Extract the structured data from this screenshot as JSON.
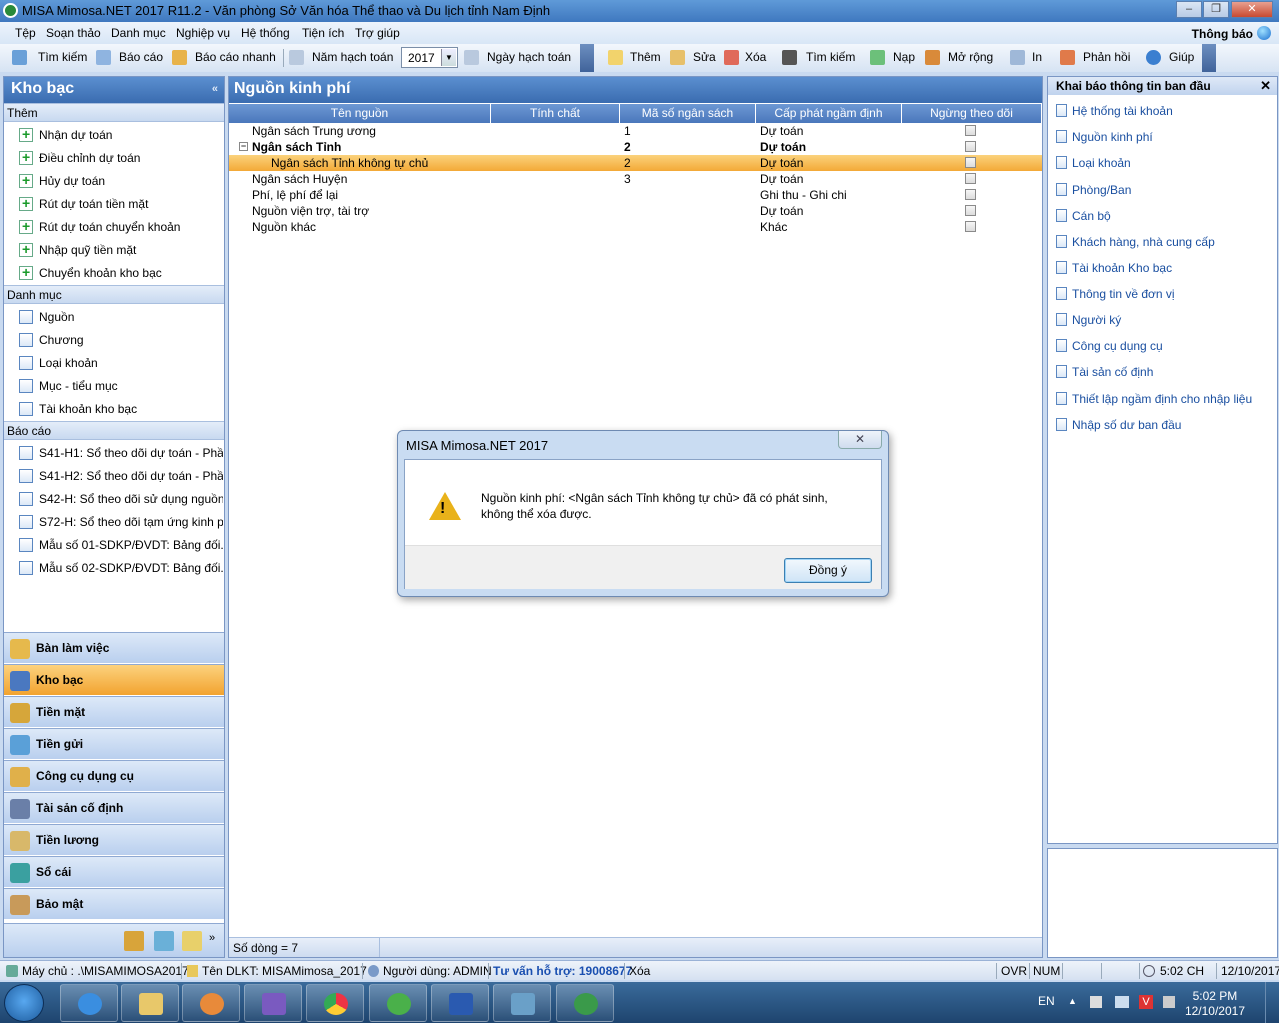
{
  "window": {
    "title": "MISA Mimosa.NET 2017 R11.2 - Văn phòng Sở Văn hóa Thể thao và Du lịch tỉnh Nam Định"
  },
  "menu": {
    "items": [
      "Tệp",
      "Soạn thảo",
      "Danh mục",
      "Nghiệp vụ",
      "Hệ thống",
      "Tiện ích",
      "Trợ giúp"
    ],
    "notice": "Thông báo"
  },
  "toolbar": {
    "tim_kiem": "Tìm kiếm",
    "bao_cao": "Báo cáo",
    "bao_cao_nhanh": "Báo cáo nhanh",
    "nam_hach_toan": "Năm hạch toán",
    "year": "2017",
    "ngay_hach_toan": "Ngày hạch toán",
    "them": "Thêm",
    "sua": "Sửa",
    "xoa": "Xóa",
    "tim_kiem2": "Tìm kiếm",
    "nap": "Nạp",
    "mo_rong": "Mở rộng",
    "in": "In",
    "phan_hoi": "Phản hồi",
    "giup": "Giúp"
  },
  "left": {
    "title": "Kho bạc",
    "sec_them": "Thêm",
    "them_items": [
      "Nhận dự toán",
      "Điều chỉnh dự toán",
      "Hủy dự toán",
      "Rút dự toán tiền mặt",
      "Rút dự toán chuyển khoản",
      "Nhập quỹ tiền mặt",
      "Chuyển khoản kho bạc"
    ],
    "sec_danhmuc": "Danh mục",
    "danhmuc_items": [
      "Nguồn",
      "Chương",
      "Loại khoản",
      "Mục - tiểu mục",
      "Tài khoản kho bạc"
    ],
    "sec_baocao": "Báo cáo",
    "baocao_items": [
      "S41-H1: Sổ theo dõi dự toán - Phầ...",
      "S41-H2: Sổ theo dõi dự toán - Phầ...",
      "S42-H: Sổ theo dõi sử dụng nguồn...",
      "S72-H: Sổ theo dõi tạm ứng kinh p...",
      "Mẫu số 01-SDKP/ĐVDT: Bảng đối...",
      "Mẫu số 02-SDKP/ĐVDT: Bảng đối..."
    ],
    "nav": [
      "Bàn làm việc",
      "Kho bạc",
      "Tiền mặt",
      "Tiền gửi",
      "Công cụ dụng cụ",
      "Tài sản cố định",
      "Tiền lương",
      "Sổ cái",
      "Bảo mật"
    ]
  },
  "center": {
    "title": "Nguồn kinh phí",
    "columns": [
      "Tên nguồn",
      "Tính chất",
      "Mã số ngân sách",
      "Cấp phát ngầm định",
      "Ngừng theo dõi"
    ],
    "rows": [
      {
        "name": "Ngân sách Trung ương",
        "code": "1",
        "alloc": "Dự toán"
      },
      {
        "name": "Ngân sách Tỉnh",
        "code": "2",
        "alloc": "Dự toán"
      },
      {
        "name": "Ngân sách Tỉnh không tự chủ",
        "code": "2",
        "alloc": "Dự toán"
      },
      {
        "name": "Ngân sách Huyện",
        "code": "3",
        "alloc": "Dự toán"
      },
      {
        "name": "Phí, lệ phí để lại",
        "code": "",
        "alloc": "Ghi thu - Ghi chi"
      },
      {
        "name": "Nguồn viện trợ, tài trợ",
        "code": "",
        "alloc": "Dự toán"
      },
      {
        "name": "Nguồn khác",
        "code": "",
        "alloc": "Khác"
      }
    ],
    "row_count": "Số dòng = 7"
  },
  "right": {
    "title": "Khai báo thông tin ban đầu",
    "links": [
      "Hệ thống tài khoản",
      "Nguồn kinh phí",
      "Loại khoản",
      "Phòng/Ban",
      "Cán bộ",
      "Khách hàng, nhà cung cấp",
      "Tài khoản Kho bạc",
      "Thông tin về đơn vị",
      "Người ký",
      "Công cụ dụng cụ",
      "Tài sản cố định",
      "Thiết lập ngầm định cho nhập liệu",
      "Nhập số dư ban đầu"
    ]
  },
  "status": {
    "may_chu": "Máy chủ : .\\MISAMIMOSA2017",
    "ten_dlkt": "Tên DLKT: MISAMimosa_2017",
    "nguoi_dung": "Người dùng: ADMIN",
    "tu_van": "Tư vấn hỗ trợ: 19008677",
    "action": "Xóa",
    "ovr": "OVR",
    "num": "NUM",
    "time": "5:02 CH",
    "date": "12/10/2017"
  },
  "taskbar": {
    "lang": "EN",
    "time": "5:02 PM",
    "date": "12/10/2017"
  },
  "dialog": {
    "title": "MISA Mimosa.NET 2017",
    "line1": "Nguồn kinh phí: <Ngân sách Tỉnh không tự chủ>  đã có phát sinh,",
    "line2": "không thể xóa được.",
    "ok": "Đồng ý"
  }
}
